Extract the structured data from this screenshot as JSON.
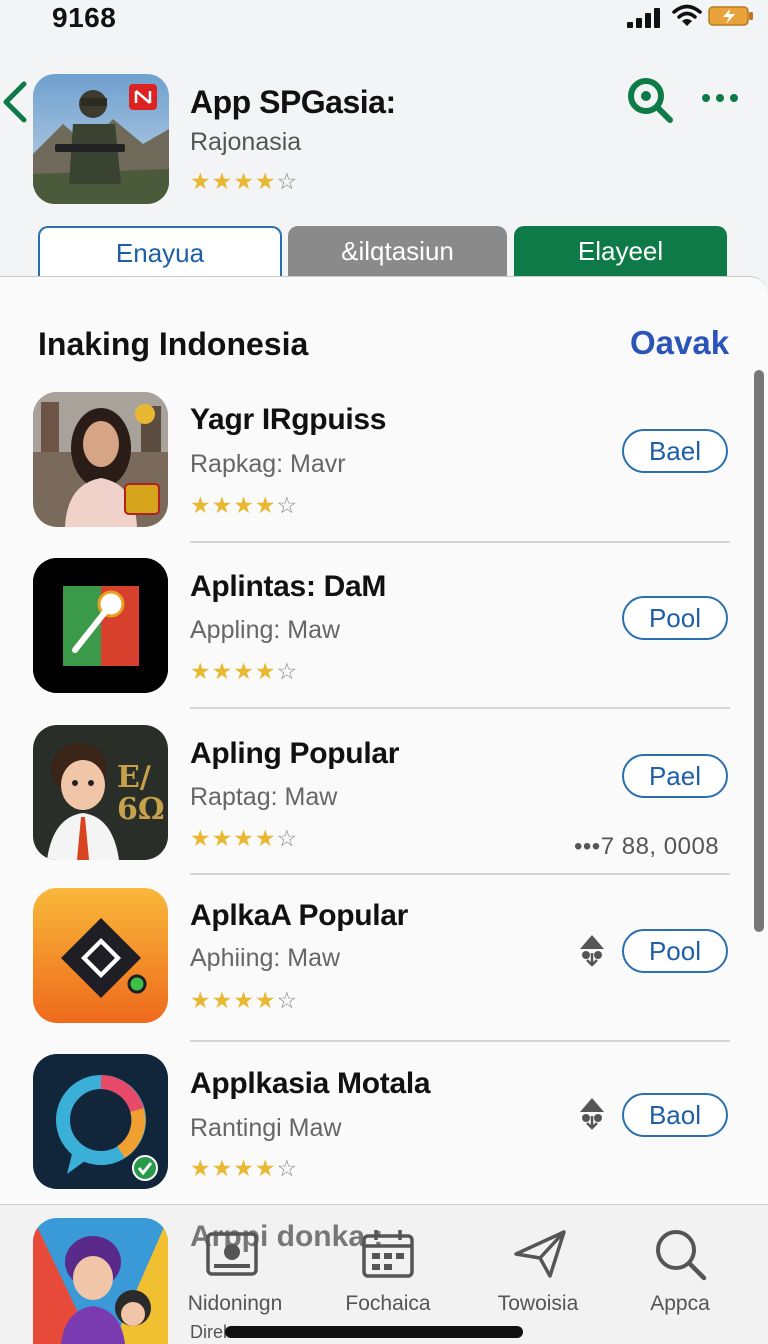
{
  "status_bar": {
    "time": "9168"
  },
  "header": {
    "title": "App SPGasia:",
    "subtitle": "Rajonasia",
    "rating": "★★★★",
    "rating_empty": "☆"
  },
  "tabs": [
    {
      "label": "Enayua"
    },
    {
      "label": "&ilqtasiun"
    },
    {
      "label": "Elayeel"
    }
  ],
  "section": {
    "title": "Inaking Indonesia",
    "link": "Oavak"
  },
  "apps": [
    {
      "title": "Yagr IRgpuiss",
      "subtitle": "Rapkag: Mavr",
      "button": "Bael"
    },
    {
      "title": "Aplintas: DaM",
      "subtitle": "Appling: Maw",
      "button": "Pool"
    },
    {
      "title": "Apling Popular",
      "subtitle": "Raptag: Maw",
      "button": "Pael",
      "downloads": "•••7 88, 0008"
    },
    {
      "title": "AplkaA Popular",
      "subtitle": "Aphiing: Maw",
      "button": "Pool"
    },
    {
      "title": "Applkasia Motala",
      "subtitle": "Rantingi Maw",
      "button": "Baol"
    }
  ],
  "partial_row": {
    "title": "Arppi donka :"
  },
  "tab_bar": {
    "items": [
      {
        "label": "Nidoningn",
        "icon": "today-icon"
      },
      {
        "label": "Fochaica",
        "icon": "calendar-icon"
      },
      {
        "label": "Towoisia",
        "icon": "send-icon"
      },
      {
        "label": "Appca",
        "icon": "search-icon"
      }
    ],
    "sub_label": "Direkt"
  },
  "colors": {
    "accent_blue": "#2a6fb0",
    "link_blue": "#2b54b8",
    "accent_green": "#0d7a48",
    "star_gold": "#e8b832"
  }
}
